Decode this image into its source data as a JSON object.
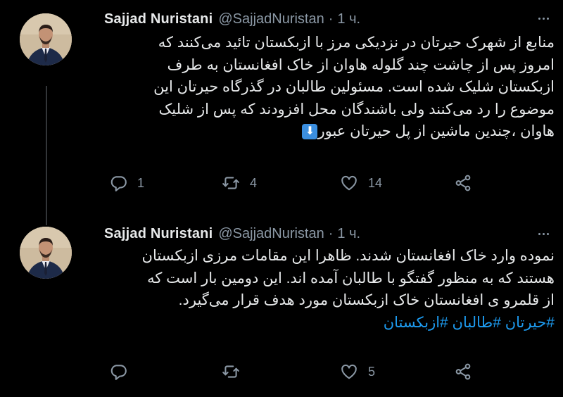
{
  "tweets": [
    {
      "author_name": "Sajjad Nuristani",
      "handle": "@SajjadNuristan",
      "separator": "·",
      "time": "1 ч.",
      "lines": [
        "منابع از شهرک حیرتان در نزدیکی مرز با ازبکستان تائید می‌کنند که",
        "امروز پس از چاشت چند گلوله هاوان از خاک افغانستان به طرف",
        "ازبکستان شلیک شده است. مسئولین طالبان در گذرگاه حیرتان این",
        "موضوع را رد می‌کنند ولی باشندگان محل افزودند که پس از شلیک",
        "هاوان ،چندین ماشین از پل حیرتان عبور"
      ],
      "arrow_emoji": "⬇",
      "reply_count": "1",
      "retweet_count": "4",
      "like_count": "14"
    },
    {
      "author_name": "Sajjad Nuristani",
      "handle": "@SajjadNuristan",
      "separator": "·",
      "time": "1 ч.",
      "lines": [
        "نموده وارد خاک افغانستان شدند. ظاهرا این مقامات مرزی ازبکستان",
        "هستند که به منظور گفتگو با طالبان آمده اند. این دومین بار است که",
        "از قلمرو ی افغانستان خاک ازبکستان مورد هدف قرار می‌گیرد."
      ],
      "hashtags": "#حیرتان #طالبان #ازبکستان",
      "reply_count": "",
      "retweet_count": "",
      "like_count": "5"
    }
  ],
  "colors": {
    "background": "#000000",
    "text": "#e7e9ea",
    "secondary": "#8b98a5",
    "accent": "#1d9bf0"
  },
  "icons": [
    "more-icon",
    "reply-icon",
    "retweet-icon",
    "like-icon",
    "share-icon"
  ]
}
